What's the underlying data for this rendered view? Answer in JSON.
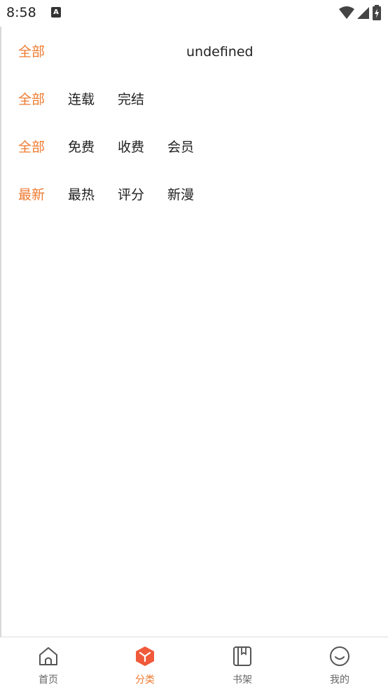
{
  "status_bar": {
    "time": "8:58",
    "app_icon_letter": "A"
  },
  "filters": {
    "row1": {
      "active": "全部",
      "undefined_text": "undefined"
    },
    "row2": {
      "items": [
        "全部",
        "连载",
        "完结"
      ]
    },
    "row3": {
      "items": [
        "全部",
        "免费",
        "收费",
        "会员"
      ]
    },
    "row4": {
      "items": [
        "最新",
        "最热",
        "评分",
        "新漫"
      ]
    }
  },
  "tabbar": {
    "tabs": [
      {
        "label": "首页",
        "icon": "home-icon"
      },
      {
        "label": "分类",
        "icon": "category-icon"
      },
      {
        "label": "书架",
        "icon": "bookshelf-icon"
      },
      {
        "label": "我的",
        "icon": "profile-icon"
      }
    ],
    "active_color": "#ee7a2f",
    "inactive_color": "#666666"
  }
}
